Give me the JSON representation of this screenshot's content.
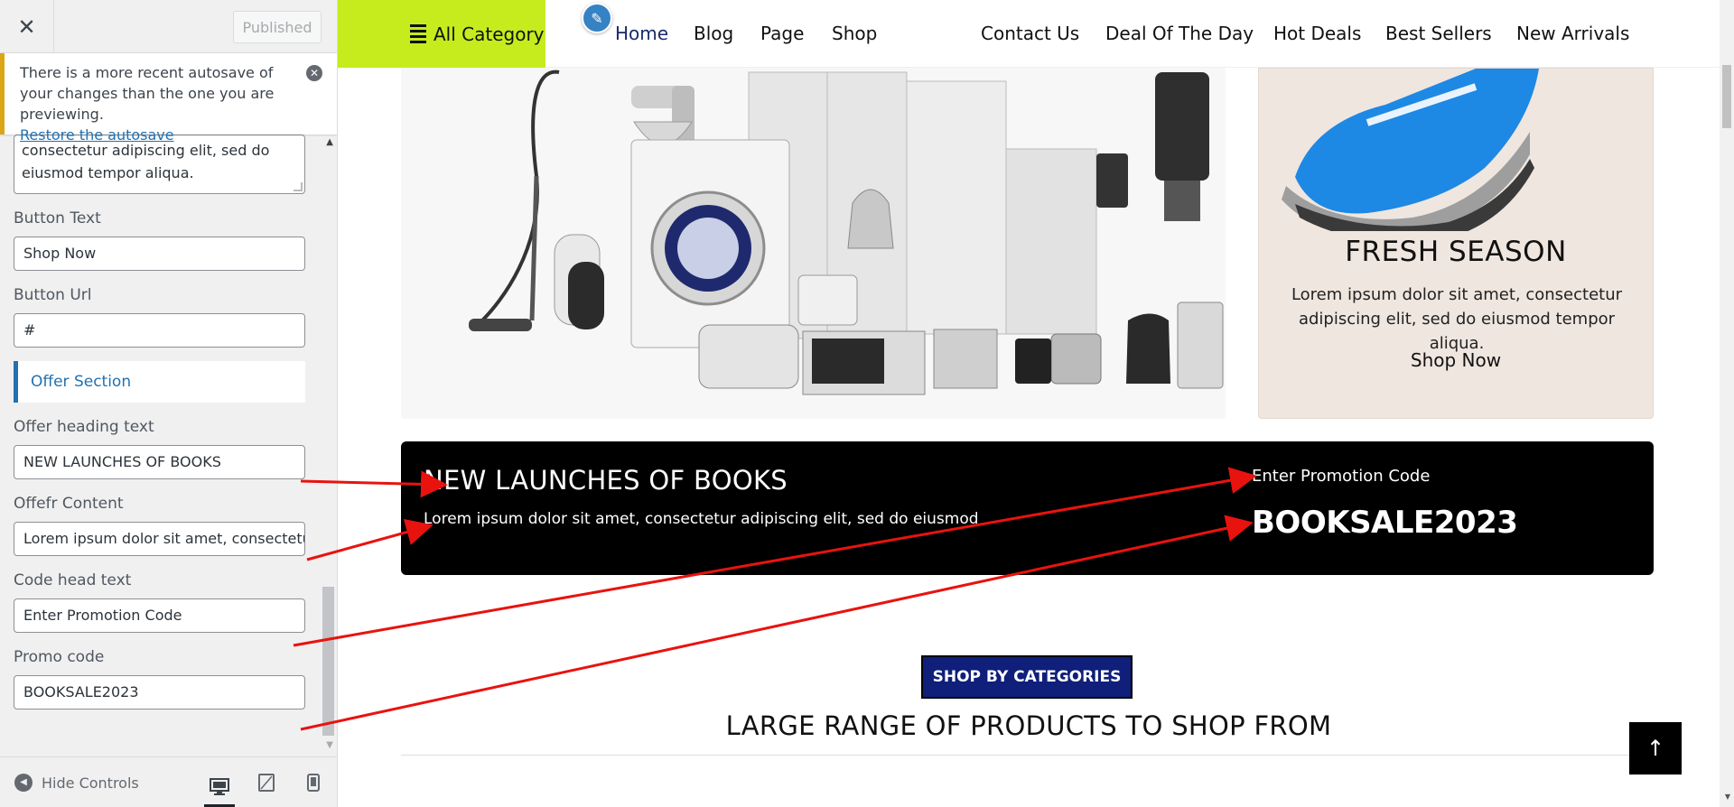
{
  "customizer": {
    "close_glyph": "✕",
    "publish_label": "Published",
    "notice": {
      "text": "There is a more recent autosave of your changes than the one you are previewing.",
      "link": "Restore the autosave"
    },
    "textarea_value": "consectetur adipiscing elit, sed do eiusmod tempor aliqua.",
    "fields": {
      "button_text_label": "Button Text",
      "button_text_value": "Shop Now",
      "button_url_label": "Button Url",
      "button_url_value": "#",
      "offer_section_label": "Offer Section",
      "offer_heading_label": "Offer heading text",
      "offer_heading_value": "NEW LAUNCHES OF BOOKS",
      "offer_content_label": "Offefr Content",
      "offer_content_value": "Lorem ipsum dolor sit amet, consectetur adipiscing elit, sed do eiusmod",
      "code_head_label": "Code head text",
      "code_head_value": "Enter Promotion Code",
      "promo_code_label": "Promo code",
      "promo_code_value": "BOOKSALE2023"
    },
    "footer": {
      "hide_controls": "Hide Controls"
    }
  },
  "preview": {
    "nav": {
      "all_category": "All Category",
      "links": [
        "Home",
        "Blog",
        "Page",
        "Shop",
        "Contact Us",
        "Deal Of The Day",
        "Hot Deals",
        "Best Sellers",
        "New Arrivals"
      ]
    },
    "fresh_season": {
      "title": "FRESH SEASON",
      "text": "Lorem ipsum dolor sit amet, consectetur adipiscing elit, sed do eiusmod tempor aliqua.",
      "button": "Shop Now"
    },
    "offer": {
      "heading": "NEW LAUNCHES OF BOOKS",
      "content": "Lorem ipsum dolor sit amet, consectetur adipiscing elit, sed do eiusmod",
      "code_head": "Enter Promotion Code",
      "promo_code": "BOOKSALE2023"
    },
    "categories": {
      "button": "SHOP BY CATEGORIES",
      "heading": "LARGE RANGE OF PRODUCTS TO SHOP FROM"
    },
    "back_to_top_glyph": "↑"
  },
  "colors": {
    "accent_green": "#c6ec1e",
    "offer_bg": "#000000",
    "category_button": "#0f1f7a",
    "annotation_arrow": "#e8130f"
  }
}
